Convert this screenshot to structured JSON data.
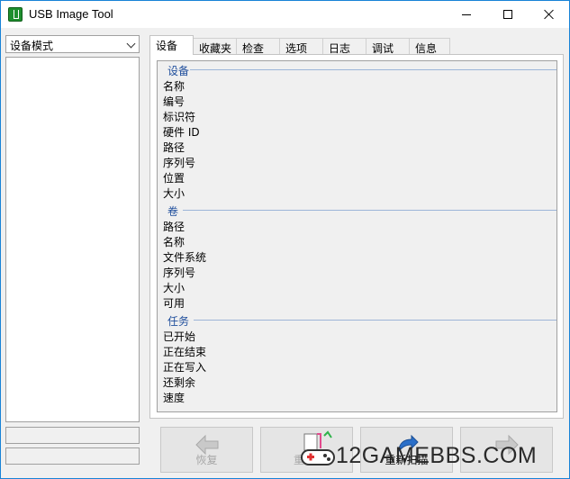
{
  "window": {
    "title": "USB Image Tool"
  },
  "left_panel": {
    "mode_select": "设备模式"
  },
  "tabs": [
    {
      "label": "设备",
      "active": true
    },
    {
      "label": "收藏夹",
      "active": false
    },
    {
      "label": "检查",
      "active": false
    },
    {
      "label": "选项",
      "active": false
    },
    {
      "label": "日志",
      "active": false
    },
    {
      "label": "调试",
      "active": false
    },
    {
      "label": "信息",
      "active": false
    }
  ],
  "info": {
    "device": {
      "header": "设备",
      "rows": [
        "名称",
        "编号",
        "标识符",
        "硬件 ID",
        "路径",
        "序列号",
        "位置",
        "大小"
      ]
    },
    "volume": {
      "header": "卷",
      "rows": [
        "路径",
        "名称",
        "文件系统",
        "序列号",
        "大小",
        "可用"
      ]
    },
    "task": {
      "header": "任务",
      "rows": [
        "已开始",
        "正在结束",
        "正在写入",
        "还剩余",
        "速度"
      ]
    }
  },
  "buttons": {
    "restore": "恢复",
    "backup": "重",
    "rescan": "重新扫描",
    "next": ""
  },
  "watermark": "12GAMEBBS.COM",
  "colors": {
    "title_border": "#1883d7",
    "section_header": "#1f4e9c",
    "arrow_gray": "#a9a9a9",
    "arrow_blue": "#2a6fc9"
  }
}
